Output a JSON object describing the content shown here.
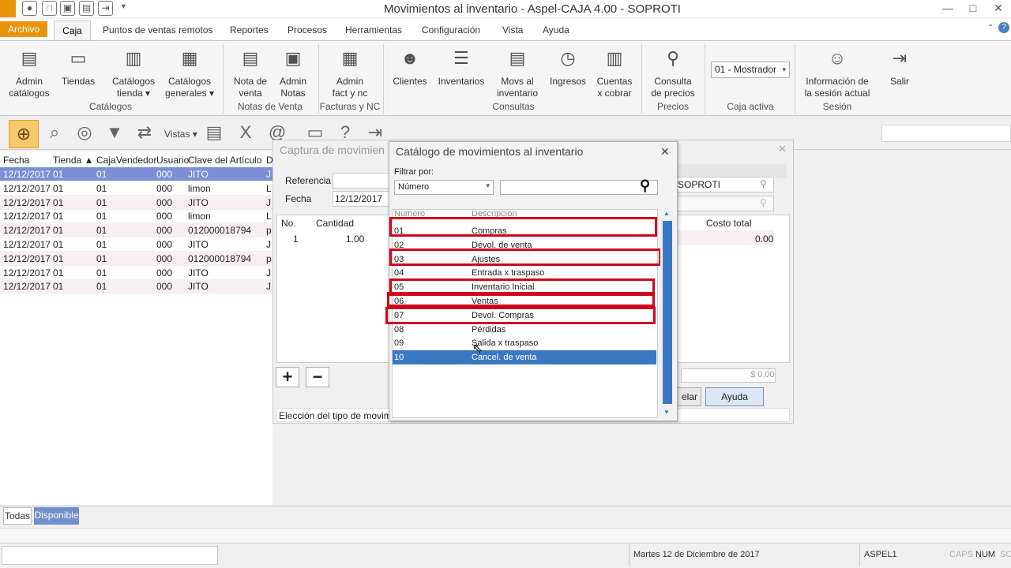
{
  "window": {
    "title": "Movimientos al inventario - Aspel-CAJA 4.00 - SOPROTI",
    "minimize": "—",
    "maximize": "□",
    "close": "✕"
  },
  "menu": {
    "file": "Archivo",
    "tabs": [
      "Caja",
      "Puntos de ventas remotos",
      "Reportes",
      "Procesos",
      "Herramientas",
      "Configuración",
      "Vista",
      "Ayuda"
    ]
  },
  "ribbon": {
    "admin_catalogos": "Admin\ncatálogos",
    "tiendas": "Tiendas",
    "catalogos_tienda": "Catálogos\ntienda ▾",
    "catalogos_generales": "Catálogos\ngenerales ▾",
    "group_catalogos": "Catálogos",
    "nota_venta": "Nota de\nventa",
    "admin_notas": "Admin\nNotas",
    "group_notas": "Notas de Venta",
    "admin_fact": "Admin\nfact y nc",
    "group_facturas": "Facturas y NC",
    "clientes": "Clientes",
    "inventarios": "Inventarios",
    "movs": "Movs al\ninventario",
    "ingresos": "Ingresos",
    "cuentas": "Cuentas\nx cobrar",
    "group_consultas": "Consultas",
    "consulta_precios": "Consulta\nde precios",
    "group_precios": "Precios",
    "caja_value": "01 - Mostrador",
    "group_caja": "Caja activa",
    "info_sesion": "Información de\nla sesión actual",
    "salir": "Salir",
    "group_sesion": "Sesión"
  },
  "toolbar": {
    "vistas": "Vistas ▾"
  },
  "grid": {
    "columns": [
      "Fecha",
      "Tienda ▲",
      "Caja",
      "Vendedor",
      "Usuario",
      "Clave del Artículo",
      "D"
    ],
    "rows": [
      [
        "12/12/2017",
        "01",
        "01",
        "",
        "000",
        "JITO",
        "J"
      ],
      [
        "12/12/2017",
        "01",
        "01",
        "",
        "000",
        "limon",
        "L"
      ],
      [
        "12/12/2017",
        "01",
        "01",
        "",
        "000",
        "JITO",
        "J"
      ],
      [
        "12/12/2017",
        "01",
        "01",
        "",
        "000",
        "limon",
        "L"
      ],
      [
        "12/12/2017",
        "01",
        "01",
        "",
        "000",
        "012000018794",
        "p"
      ],
      [
        "12/12/2017",
        "01",
        "01",
        "",
        "000",
        "JITO",
        "J"
      ],
      [
        "12/12/2017",
        "01",
        "01",
        "",
        "000",
        "012000018794",
        "p"
      ],
      [
        "12/12/2017",
        "01",
        "01",
        "",
        "000",
        "JITO",
        "J"
      ],
      [
        "12/12/2017",
        "01",
        "01",
        "",
        "000",
        "JITO",
        "J"
      ]
    ]
  },
  "captura": {
    "title": "Captura de movimien",
    "referencia_label": "Referencia",
    "fecha_label": "Fecha",
    "fecha_value": "12/12/2017",
    "proveedor_value": "SOPROTI",
    "col_no": "No.",
    "col_cantidad": "Cantidad",
    "col_costo_total": "Costo total",
    "row_no": "1",
    "row_cantidad": "1.00",
    "row_costo_total": "0.00",
    "total": "$ 0.00",
    "cancelar_partial": "elar",
    "ayuda": "Ayuda",
    "status": "Elección del tipo de movimien"
  },
  "catalog": {
    "title": "Catálogo de movimientos al inventario",
    "filter_label": "Filtrar por:",
    "filter_value": "Número",
    "col_numero": "Número",
    "col_descripcion": "Descripción",
    "items": [
      {
        "num": "01",
        "desc": "Compras"
      },
      {
        "num": "02",
        "desc": "Devol. de venta"
      },
      {
        "num": "03",
        "desc": "Ajustes"
      },
      {
        "num": "04",
        "desc": "Entrada x traspaso"
      },
      {
        "num": "05",
        "desc": "Inventario Inicial"
      },
      {
        "num": "06",
        "desc": "Ventas"
      },
      {
        "num": "07",
        "desc": "Devol. Compras"
      },
      {
        "num": "08",
        "desc": "Pérdidas"
      },
      {
        "num": "09",
        "desc": "Salida x traspaso"
      },
      {
        "num": "10",
        "desc": "Cancel. de venta"
      }
    ]
  },
  "bottom": {
    "tab_todas": "Todas",
    "tab_disponible": "Disponible"
  },
  "status": {
    "date": "Martes 12 de Diciembre de 2017",
    "user": "ASPEL1",
    "caps": "CAPS",
    "num": "NUM",
    "scrl": "SC"
  },
  "colors": {
    "accent_orange": "#e8950a",
    "selection_blue": "#3b78c4",
    "highlight_red": "#d0021b"
  }
}
